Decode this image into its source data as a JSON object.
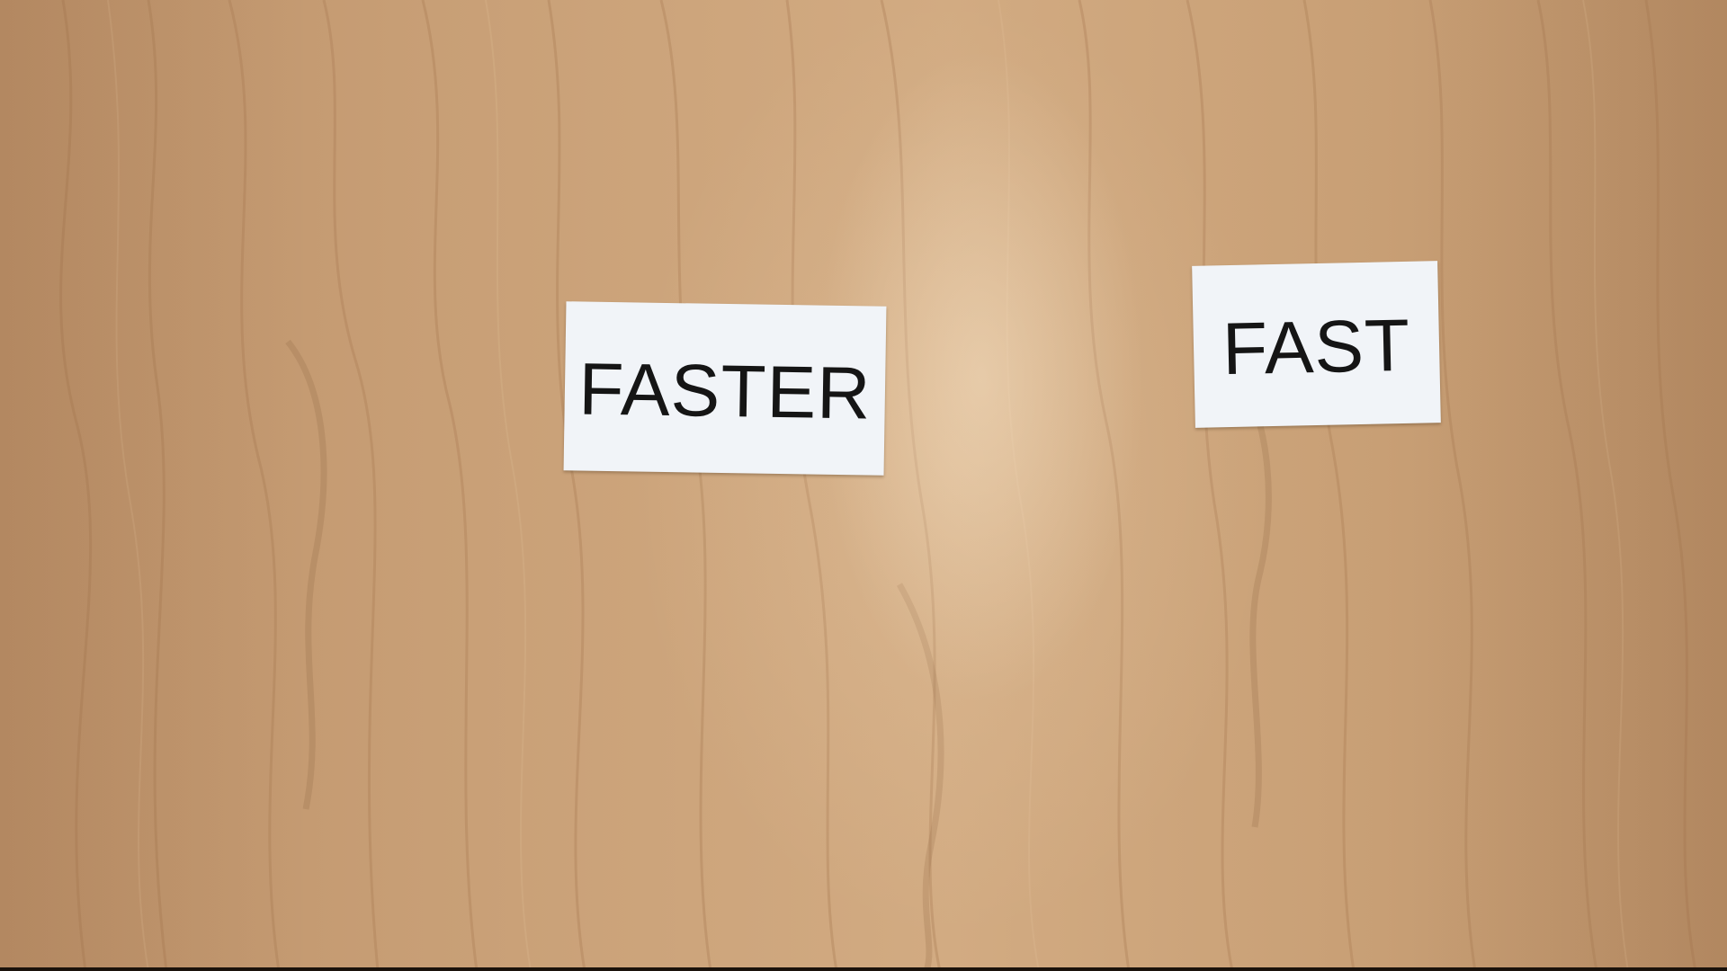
{
  "cards": {
    "faster": "FASTER",
    "fast": "FAST"
  },
  "colors": {
    "wood": "#c8a077",
    "card": "#f1f4f8",
    "text": "#151515"
  }
}
